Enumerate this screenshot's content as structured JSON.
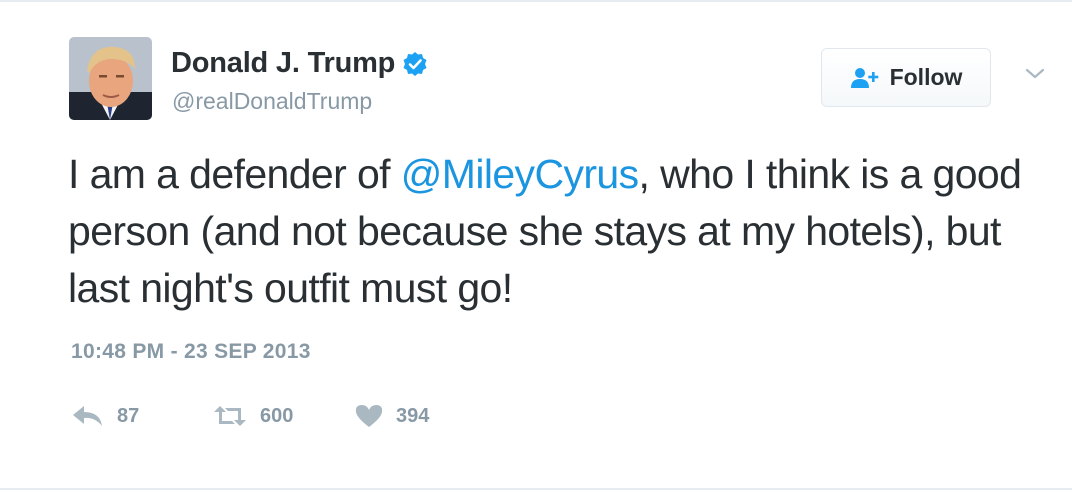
{
  "user": {
    "display_name": "Donald J. Trump",
    "handle": "@realDonaldTrump",
    "verified": true
  },
  "follow_button": {
    "label": "Follow",
    "icon": "add-user-icon"
  },
  "menu": {
    "icon": "chevron-down-icon"
  },
  "tweet": {
    "text_before": "I am a defender of ",
    "mention": "@MileyCyrus",
    "text_after": ", who I think is a good person (and not because she stays at my hotels), but last night's outfit must go!",
    "timestamp": "10:48 PM - 23 SEP 2013"
  },
  "actions": {
    "reply": {
      "icon": "reply-icon",
      "count": "87"
    },
    "retweet": {
      "icon": "retweet-icon",
      "count": "600"
    },
    "like": {
      "icon": "heart-icon",
      "count": "394"
    }
  },
  "colors": {
    "text": "#292f33",
    "secondary": "#8899a6",
    "link": "#1b95e0",
    "verified": "#1da1f2",
    "border": "#e6ecf0"
  }
}
